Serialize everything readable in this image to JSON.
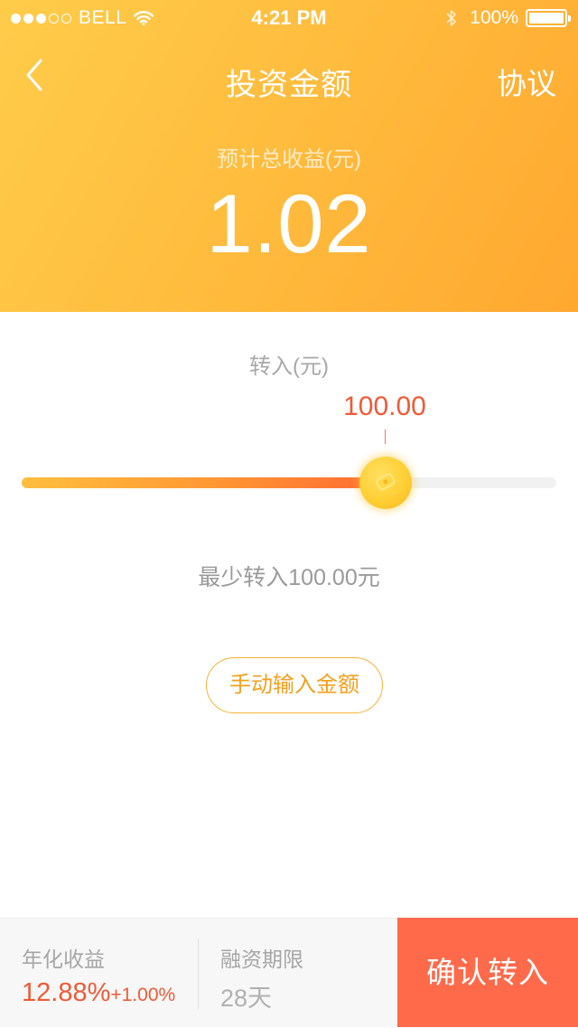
{
  "status_bar": {
    "carrier": "BELL",
    "time": "4:21 PM",
    "battery": "100%"
  },
  "nav": {
    "title": "投资金额",
    "agreement_label": "协议"
  },
  "earnings": {
    "label": "预计总收益(元)",
    "value": "1.02"
  },
  "transfer": {
    "label": "转入(元)",
    "value": "100.00",
    "slider_fraction": 0.68,
    "min_note": "最少转入100.00元"
  },
  "manual_input_label": "手动输入金额",
  "footer": {
    "yield_label": "年化收益",
    "yield_value": "12.88%",
    "yield_bonus": "+1.00%",
    "term_label": "融资期限",
    "term_value": "28天"
  },
  "confirm_label": "确认转入",
  "colors": {
    "header_start": "#ffcc4a",
    "header_end": "#ffa830",
    "accent_red": "#f05a36",
    "confirm_bg": "#ff6a4b",
    "outline_orange": "#f6b233"
  },
  "icons": {
    "back": "chevron-left-icon",
    "thumb": "coin-icon"
  }
}
